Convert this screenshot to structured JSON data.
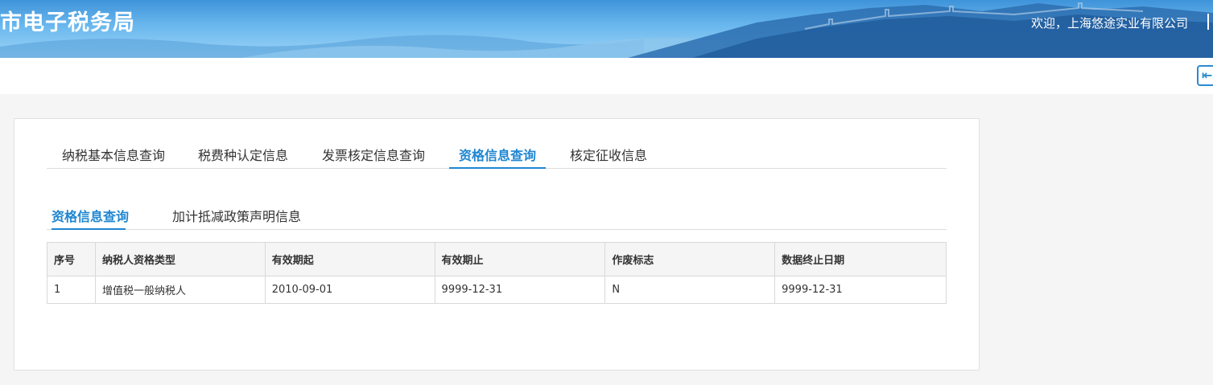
{
  "header": {
    "site_title": "市电子税务局",
    "welcome_text": "欢迎，上海悠途实业有限公司"
  },
  "toolbar": {
    "exit_icon": "logout-arrow-icon",
    "exit_glyph": "⇤"
  },
  "main_tabs": [
    {
      "label": "纳税基本信息查询",
      "active": false
    },
    {
      "label": "税费种认定信息",
      "active": false
    },
    {
      "label": "发票核定信息查询",
      "active": false
    },
    {
      "label": "资格信息查询",
      "active": true
    },
    {
      "label": "核定征收信息",
      "active": false
    }
  ],
  "sub_tabs": [
    {
      "label": "资格信息查询",
      "active": true
    },
    {
      "label": "加计抵减政策声明信息",
      "active": false
    }
  ],
  "table": {
    "columns": [
      "序号",
      "纳税人资格类型",
      "有效期起",
      "有效期止",
      "作废标志",
      "数据终止日期"
    ],
    "rows": [
      [
        "1",
        "增值税一般纳税人",
        "2010-09-01",
        "9999-12-31",
        "N",
        "9999-12-31"
      ]
    ]
  },
  "colors": {
    "accent": "#1f86d1",
    "banner_top": "#3f93d9",
    "banner_bottom": "#9ed4f6"
  }
}
